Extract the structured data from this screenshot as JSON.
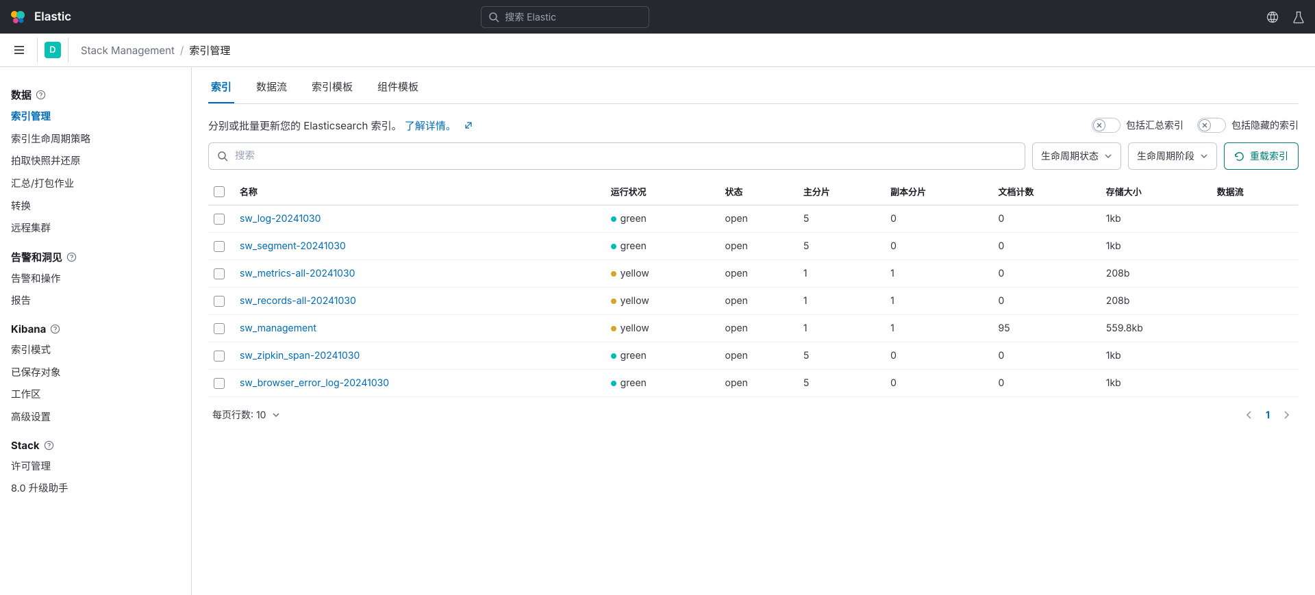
{
  "header": {
    "brand": "Elastic",
    "search_placeholder": "搜索 Elastic",
    "space_letter": "D"
  },
  "breadcrumb": {
    "parent": "Stack Management",
    "sep": "/",
    "current": "索引管理"
  },
  "sidebar": {
    "sections": [
      {
        "title": "数据",
        "items": [
          "索引管理",
          "索引生命周期策略",
          "拍取快照并还原",
          "汇总/打包作业",
          "转换",
          "远程集群"
        ],
        "active_index": 0
      },
      {
        "title": "告警和洞见",
        "items": [
          "告警和操作",
          "报告"
        ]
      },
      {
        "title": "Kibana",
        "items": [
          "索引模式",
          "已保存对象",
          "工作区",
          "高级设置"
        ]
      },
      {
        "title": "Stack",
        "items": [
          "许可管理",
          "8.0 升级助手"
        ]
      }
    ]
  },
  "tabs": {
    "items": [
      "索引",
      "数据流",
      "索引模板",
      "组件模板"
    ],
    "active_index": 0
  },
  "description": {
    "text": "分别或批量更新您的 Elasticsearch 索引。",
    "link": "了解详情。"
  },
  "toggles": {
    "rollup": "包括汇总索引",
    "hidden": "包括隐藏的索引"
  },
  "filters": {
    "search_placeholder": "搜索",
    "lifecycle_state": "生命周期状态",
    "lifecycle_phase": "生命周期阶段",
    "reload": "重载索引"
  },
  "table": {
    "headers": [
      "名称",
      "运行状况",
      "状态",
      "主分片",
      "副本分片",
      "文档计数",
      "存储大小",
      "数据流"
    ],
    "rows": [
      {
        "name": "sw_log-20241030",
        "health": "green",
        "status": "open",
        "pri": "5",
        "rep": "0",
        "docs": "0",
        "size": "1kb",
        "ds": ""
      },
      {
        "name": "sw_segment-20241030",
        "health": "green",
        "status": "open",
        "pri": "5",
        "rep": "0",
        "docs": "0",
        "size": "1kb",
        "ds": ""
      },
      {
        "name": "sw_metrics-all-20241030",
        "health": "yellow",
        "status": "open",
        "pri": "1",
        "rep": "1",
        "docs": "0",
        "size": "208b",
        "ds": ""
      },
      {
        "name": "sw_records-all-20241030",
        "health": "yellow",
        "status": "open",
        "pri": "1",
        "rep": "1",
        "docs": "0",
        "size": "208b",
        "ds": ""
      },
      {
        "name": "sw_management",
        "health": "yellow",
        "status": "open",
        "pri": "1",
        "rep": "1",
        "docs": "95",
        "size": "559.8kb",
        "ds": ""
      },
      {
        "name": "sw_zipkin_span-20241030",
        "health": "green",
        "status": "open",
        "pri": "5",
        "rep": "0",
        "docs": "0",
        "size": "1kb",
        "ds": ""
      },
      {
        "name": "sw_browser_error_log-20241030",
        "health": "green",
        "status": "open",
        "pri": "5",
        "rep": "0",
        "docs": "0",
        "size": "1kb",
        "ds": ""
      }
    ]
  },
  "footer": {
    "rows_label_prefix": "每页行数: ",
    "rows_value": "10",
    "current_page": "1"
  }
}
